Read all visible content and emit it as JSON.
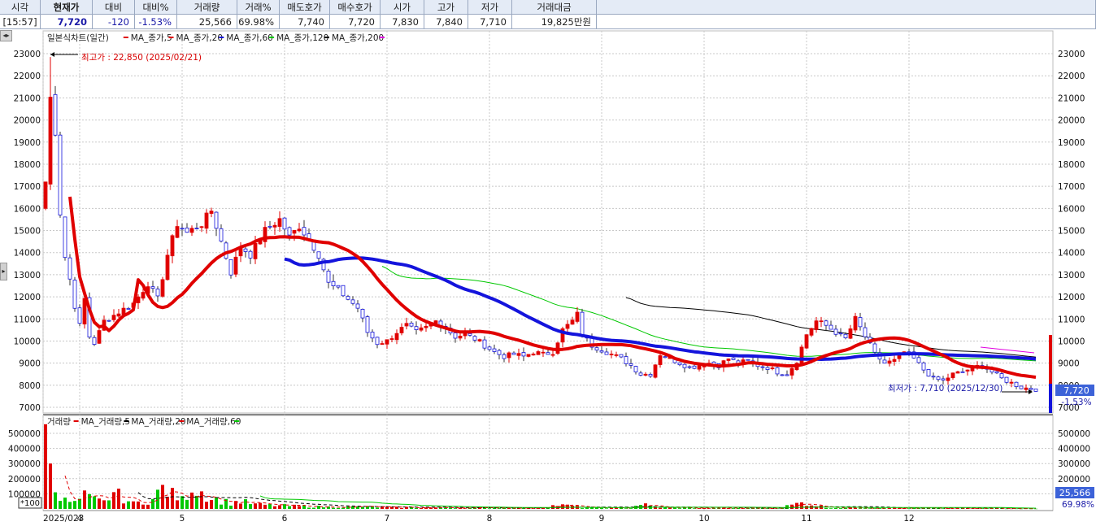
{
  "quote": {
    "headers": [
      "시각",
      "현재가",
      "대비",
      "대비%",
      "거래량",
      "거래%",
      "매도호가",
      "매수호가",
      "시가",
      "고가",
      "저가",
      "거래대금"
    ],
    "values": [
      "[15:57]",
      "7,720",
      "-120",
      "-1.53%",
      "25,566",
      "69.98%",
      "7,740",
      "7,720",
      "7,830",
      "7,840",
      "7,710",
      "19,825만원"
    ]
  },
  "price_panel": {
    "legend_title": "일본식차트(일간)",
    "legend_items": [
      {
        "label": "MA_종가,5",
        "color": "#e00000"
      },
      {
        "label": "MA_종가,20",
        "color": "#e00000"
      },
      {
        "label": "MA_종가,60",
        "color": "#1414dc"
      },
      {
        "label": "MA_종가,120",
        "color": "#00c800"
      },
      {
        "label": "MA_종가,200",
        "color": "#000000"
      },
      {
        "label": "",
        "color": "#e000e0"
      }
    ],
    "high_annotation": "최고가 : 22,850 (2025/02/21)",
    "low_annotation": "최저가 : 7,710 (2025/12/30)",
    "price_tag": "7,720",
    "change_tag": "-1.53%",
    "y_ticks": [
      "23000",
      "22000",
      "21000",
      "20000",
      "19000",
      "18000",
      "17000",
      "16000",
      "15000",
      "14000",
      "13000",
      "12000",
      "11000",
      "10000",
      "9000",
      "8000",
      "7000"
    ]
  },
  "volume_panel": {
    "legend_title": "거래량",
    "legend_items": [
      {
        "label": "MA_거래량,5",
        "color": "#e00000"
      },
      {
        "label": "MA_거래량,20",
        "color": "#000000"
      },
      {
        "label": "MA_거래량,60",
        "color": "#e00000"
      },
      {
        "label": "",
        "color": "#00c800"
      }
    ],
    "y_ticks": [
      "500000",
      "400000",
      "300000",
      "200000",
      "100000"
    ],
    "unit_label": "*100",
    "volume_tag": "25,566",
    "ratio_tag": "69.98%"
  },
  "x_axis": {
    "labels": [
      "2025/023",
      "4",
      "5",
      "6",
      "7",
      "8",
      "9",
      "10",
      "11",
      "12"
    ]
  },
  "chart_data": {
    "type": "candlestick",
    "x_unit": "day index from 2025/02/21",
    "month_starts": [
      0,
      7,
      28,
      49,
      70,
      91,
      114,
      135,
      156,
      177
    ],
    "ylim": [
      6500,
      23500
    ],
    "high": {
      "value": 22850,
      "date": "2025/02/21"
    },
    "low": {
      "value": 7710,
      "date": "2025/12/30"
    },
    "close_anchors": [
      [
        0,
        17200
      ],
      [
        1,
        21000
      ],
      [
        2,
        19500
      ],
      [
        3,
        15800
      ],
      [
        4,
        13800
      ],
      [
        5,
        12800
      ],
      [
        6,
        11600
      ],
      [
        7,
        10700
      ],
      [
        8,
        11900
      ],
      [
        9,
        10200
      ],
      [
        10,
        9900
      ],
      [
        12,
        10900
      ],
      [
        15,
        11300
      ],
      [
        18,
        11700
      ],
      [
        21,
        12600
      ],
      [
        23,
        11900
      ],
      [
        25,
        13900
      ],
      [
        27,
        15300
      ],
      [
        29,
        14900
      ],
      [
        32,
        15300
      ],
      [
        34,
        15900
      ],
      [
        36,
        14500
      ],
      [
        38,
        13100
      ],
      [
        40,
        14300
      ],
      [
        42,
        13900
      ],
      [
        45,
        15000
      ],
      [
        48,
        15500
      ],
      [
        50,
        14700
      ],
      [
        52,
        15200
      ],
      [
        54,
        14600
      ],
      [
        56,
        13900
      ],
      [
        58,
        12600
      ],
      [
        60,
        12300
      ],
      [
        62,
        11900
      ],
      [
        64,
        11500
      ],
      [
        66,
        10400
      ],
      [
        68,
        9900
      ],
      [
        70,
        10000
      ],
      [
        72,
        10400
      ],
      [
        74,
        10700
      ],
      [
        76,
        10400
      ],
      [
        78,
        10600
      ],
      [
        80,
        10900
      ],
      [
        82,
        10600
      ],
      [
        84,
        10200
      ],
      [
        86,
        10300
      ],
      [
        88,
        10100
      ],
      [
        90,
        9800
      ],
      [
        92,
        9500
      ],
      [
        94,
        9300
      ],
      [
        96,
        9400
      ],
      [
        98,
        9300
      ],
      [
        100,
        9500
      ],
      [
        102,
        9400
      ],
      [
        104,
        9500
      ],
      [
        106,
        10500
      ],
      [
        108,
        10900
      ],
      [
        109,
        11200
      ],
      [
        110,
        10300
      ],
      [
        112,
        9800
      ],
      [
        114,
        9600
      ],
      [
        116,
        9400
      ],
      [
        118,
        9200
      ],
      [
        120,
        8900
      ],
      [
        122,
        8500
      ],
      [
        124,
        8500
      ],
      [
        126,
        9400
      ],
      [
        128,
        9200
      ],
      [
        130,
        9000
      ],
      [
        132,
        8800
      ],
      [
        134,
        8900
      ],
      [
        136,
        9000
      ],
      [
        138,
        8900
      ],
      [
        140,
        9200
      ],
      [
        142,
        9000
      ],
      [
        144,
        9100
      ],
      [
        146,
        8900
      ],
      [
        148,
        8800
      ],
      [
        150,
        8600
      ],
      [
        152,
        8500
      ],
      [
        154,
        9100
      ],
      [
        156,
        10300
      ],
      [
        158,
        10900
      ],
      [
        160,
        10700
      ],
      [
        162,
        10400
      ],
      [
        164,
        10100
      ],
      [
        166,
        11000
      ],
      [
        168,
        10200
      ],
      [
        170,
        9400
      ],
      [
        172,
        9000
      ],
      [
        174,
        9100
      ],
      [
        176,
        9500
      ],
      [
        178,
        9200
      ],
      [
        180,
        8700
      ],
      [
        182,
        8300
      ],
      [
        184,
        8200
      ],
      [
        186,
        8500
      ],
      [
        188,
        8600
      ],
      [
        190,
        8800
      ],
      [
        192,
        8900
      ],
      [
        194,
        8600
      ],
      [
        196,
        8300
      ],
      [
        198,
        8100
      ],
      [
        200,
        7900
      ],
      [
        202,
        7840
      ],
      [
        203,
        7720
      ]
    ],
    "volume_anchors": [
      [
        0,
        560000
      ],
      [
        1,
        300000
      ],
      [
        2,
        110000
      ],
      [
        3,
        70000
      ],
      [
        4,
        55000
      ],
      [
        6,
        40000
      ],
      [
        8,
        85000
      ],
      [
        10,
        60000
      ],
      [
        12,
        45000
      ],
      [
        14,
        110000
      ],
      [
        16,
        70000
      ],
      [
        18,
        35000
      ],
      [
        20,
        50000
      ],
      [
        22,
        60000
      ],
      [
        24,
        140000
      ],
      [
        26,
        95000
      ],
      [
        28,
        60000
      ],
      [
        30,
        150000
      ],
      [
        32,
        115000
      ],
      [
        34,
        70000
      ],
      [
        36,
        55000
      ],
      [
        38,
        40000
      ],
      [
        40,
        50000
      ],
      [
        43,
        30000
      ],
      [
        46,
        25000
      ],
      [
        50,
        20000
      ],
      [
        55,
        15000
      ],
      [
        60,
        12000
      ],
      [
        65,
        15000
      ],
      [
        70,
        10000
      ],
      [
        80,
        8000
      ],
      [
        90,
        7000
      ],
      [
        100,
        6000
      ],
      [
        105,
        25000
      ],
      [
        108,
        20000
      ],
      [
        110,
        8000
      ],
      [
        120,
        6000
      ],
      [
        122,
        35000
      ],
      [
        125,
        10000
      ],
      [
        135,
        5000
      ],
      [
        150,
        5000
      ],
      [
        155,
        40000
      ],
      [
        158,
        25000
      ],
      [
        160,
        8000
      ],
      [
        170,
        6000
      ],
      [
        180,
        5000
      ],
      [
        190,
        4000
      ],
      [
        200,
        3000
      ],
      [
        203,
        2557
      ]
    ]
  }
}
